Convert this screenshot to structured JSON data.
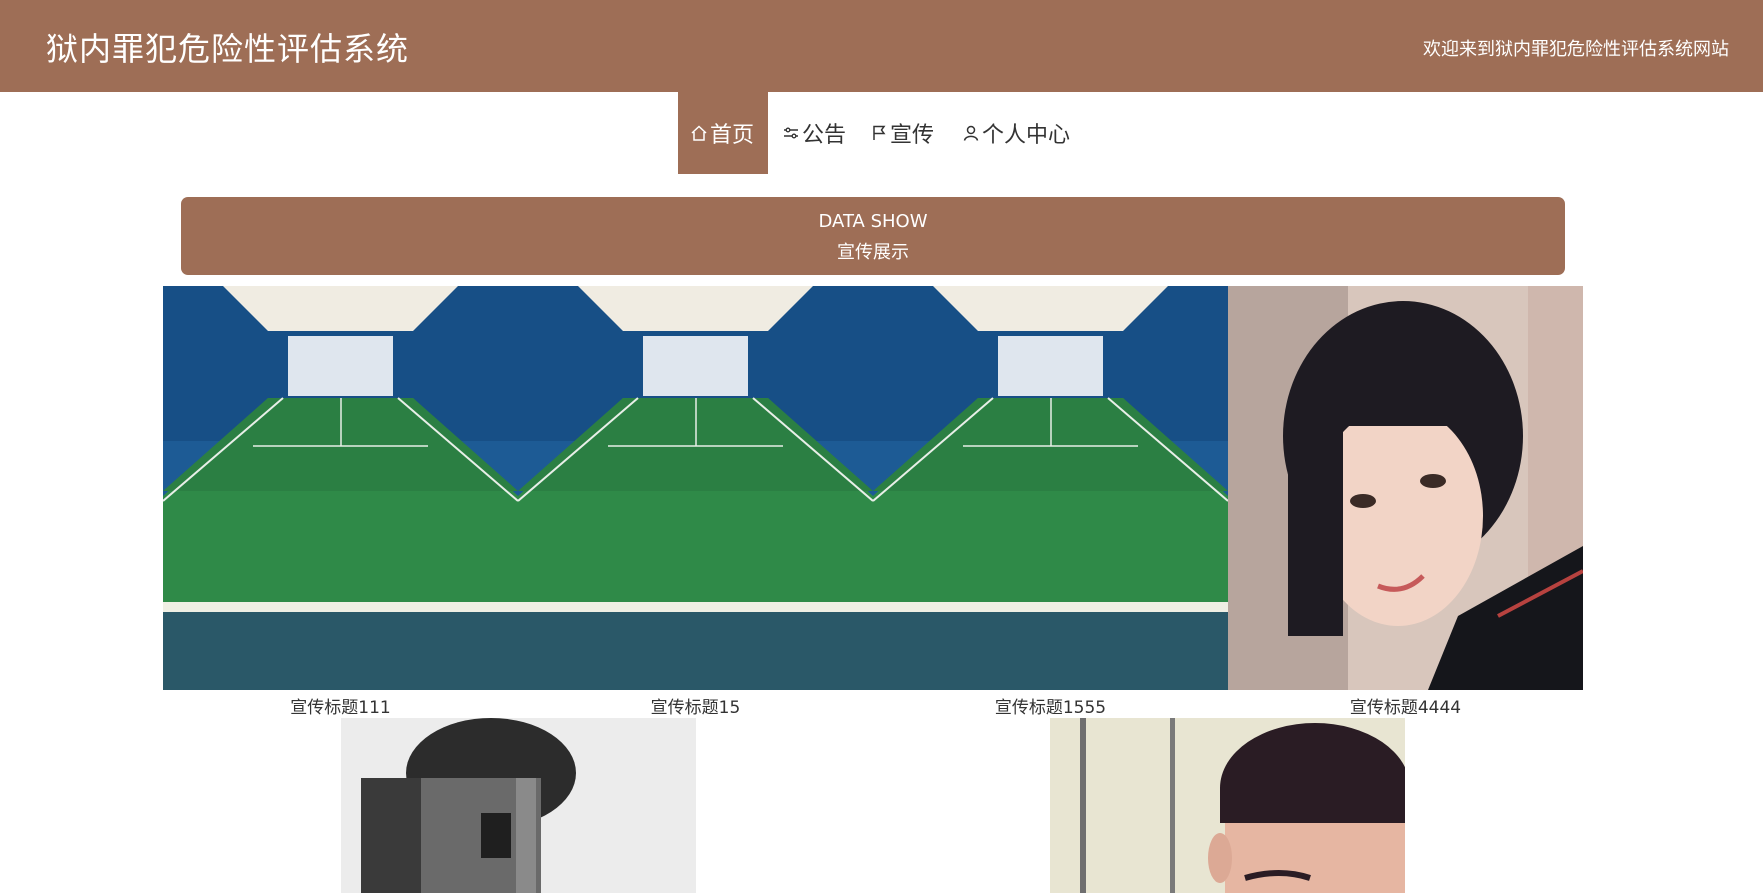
{
  "header": {
    "title": "狱内罪犯危险性评估系统",
    "welcome": "欢迎来到狱内罪犯危险性评估系统网站"
  },
  "nav": {
    "items": [
      {
        "label": "首页",
        "icon": "home-icon",
        "active": true
      },
      {
        "label": "公告",
        "icon": "sliders-icon",
        "active": false
      },
      {
        "label": "宣传",
        "icon": "flag-icon",
        "active": false
      },
      {
        "label": "个人中心",
        "icon": "user-icon",
        "active": false
      }
    ]
  },
  "section": {
    "title_en": "DATA SHOW",
    "title_cn": "宣传展示"
  },
  "cards": [
    {
      "title": "宣传标题111",
      "image": "badminton-court-photo"
    },
    {
      "title": "宣传标题15",
      "image": "badminton-court-photo"
    },
    {
      "title": "宣传标题1555",
      "image": "badminton-court-photo"
    },
    {
      "title": "宣传标题4444",
      "image": "girl-portrait-photo"
    }
  ],
  "cards_row2": [
    {
      "image": "man-bw-portrait-photo"
    },
    {
      "image": "boy-portrait-photo"
    }
  ],
  "colors": {
    "brand": "#9e6e56",
    "white": "#ffffff",
    "text": "#333333"
  }
}
